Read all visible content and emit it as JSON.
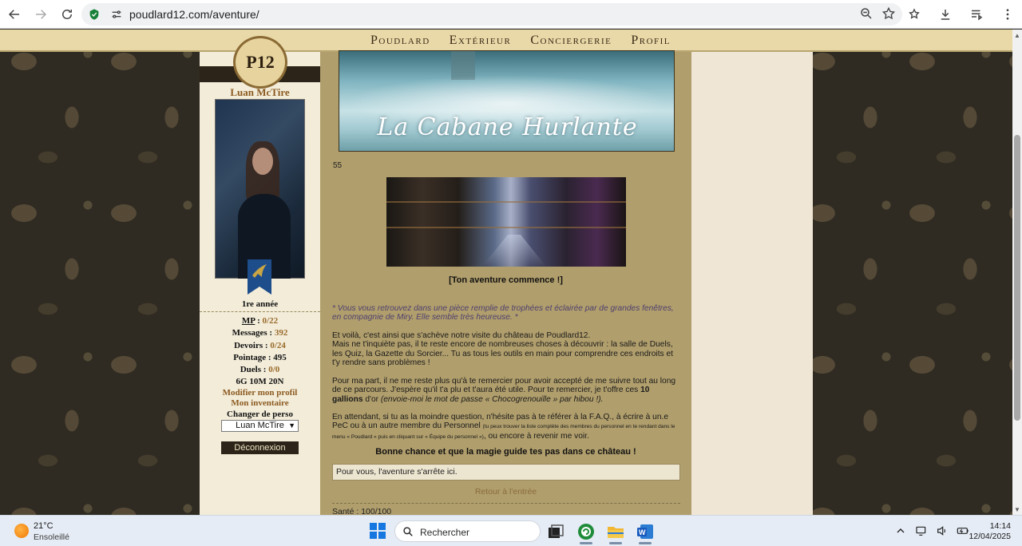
{
  "browser": {
    "url": "poudlard12.com/aventure/"
  },
  "top_menu": {
    "items": [
      "Poudlard",
      "Extérieur",
      "Conciergerie",
      "Profil"
    ]
  },
  "sidebar": {
    "logo_text": "P12",
    "character_name": "Luan McTire",
    "year": "1re année",
    "stats": {
      "mp_label": "MP",
      "mp_value": "0/22",
      "messages_label": "Messages :",
      "messages_value": "392",
      "devoirs_label": "Devoirs :",
      "devoirs_value": "0/24",
      "pointage_label": "Pointage :",
      "pointage_value": "495",
      "duels_label": "Duels :",
      "duels_value": "0/0",
      "money": "6G 10M 20N"
    },
    "links": {
      "edit_profile": "Modifier mon profil",
      "inventory": "Mon inventaire"
    },
    "change_perso_label": "Changer de perso",
    "change_perso_selected": "Luan McTire",
    "logout": "Déconnexion"
  },
  "main": {
    "banner_title": "La Cabane Hurlante",
    "post_number": "55",
    "story_heading": "[Ton aventure commence !]",
    "italic_intro": "* Vous vous retrouvez dans une pièce remplie de trophées et éclairée par de grandes fenêtres, en compagnie de Miry. Elle semble très heureuse. *",
    "para1": "Et voilà, c'est ainsi que s'achève notre visite du château de Poudlard12.",
    "para2": "Mais ne t'inquiète pas, il te reste encore de nombreuses choses à découvrir : la salle de Duels, les Quiz, la Gazette du Sorcier... Tu as tous les outils en main pour comprendre ces endroits et t'y rendre sans problèmes !",
    "para3_start": "Pour ma part, il ne me reste plus qu'à te remercier pour avoir accepté de me suivre tout au long de ce parcours. J'espère qu'il t'a plu et t'aura été utile. Pour te remercier, je t'offre ces ",
    "para3_bold": "10 gallions",
    "para3_mid": " d'or ",
    "para3_italic": "(envoie-moi le mot de passe « Chocogrenouille » par hibou !).",
    "para4_start": "En attendant, si tu as la moindre question, n'hésite pas à te référer à la F.A.Q., à écrire à un.e PeC ou à un autre membre du Personnel ",
    "para4_small": "(tu peux trouver la liste complète des membres du personnel en te rendant dans le menu « Poudlard » puis en cliquant sur « Équipe du personnel »)",
    "para4_end": ", ou encore à revenir me voir.",
    "final_line": "Bonne chance et que la magie guide tes pas dans ce château !",
    "end_box": "Pour vous, l'aventure s'arrête ici.",
    "back_link": "Retour à l'entrée",
    "health": "Santé : 100/100"
  },
  "taskbar": {
    "weather_temp": "21°C",
    "weather_desc": "Ensoleillé",
    "search_label": "Rechercher",
    "time": "14:14",
    "date": "12/04/2025"
  },
  "colors": {
    "menu_bg": "#e9d9a8",
    "main_bg": "#b09e6c",
    "sidebar_bg": "#f2ecd9",
    "accent_brown": "#8c5a20"
  }
}
